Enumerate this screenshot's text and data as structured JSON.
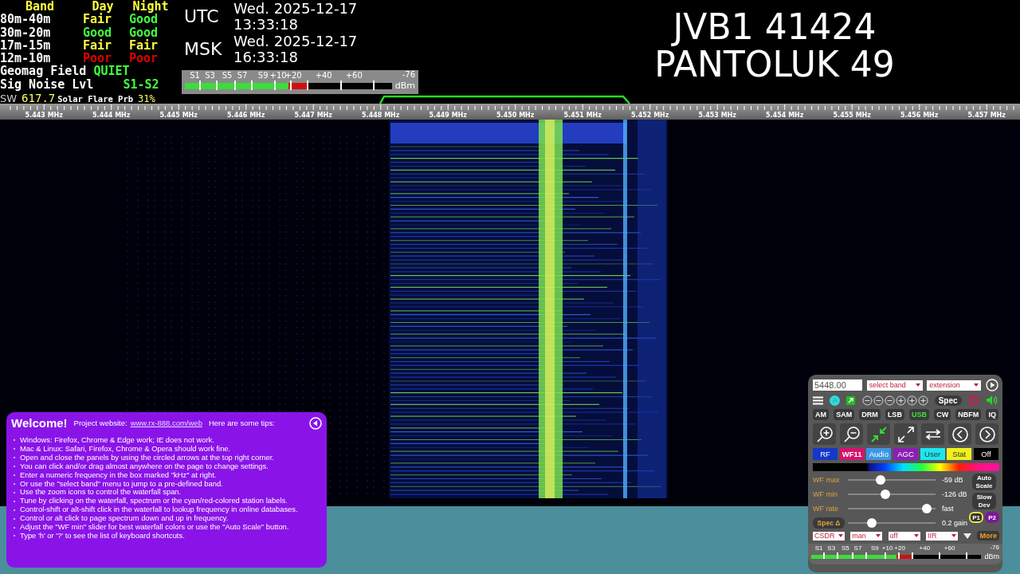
{
  "propagation": {
    "headers": [
      "Band",
      "Day",
      "Night"
    ],
    "rows": [
      {
        "band": "80m-40m",
        "day": {
          "text": "Fair",
          "color": "#ffff40"
        },
        "night": {
          "text": "Good",
          "color": "#40ff40"
        }
      },
      {
        "band": "30m-20m",
        "day": {
          "text": "Good",
          "color": "#40ff40"
        },
        "night": {
          "text": "Good",
          "color": "#40ff40"
        }
      },
      {
        "band": "17m-15m",
        "day": {
          "text": "Fair",
          "color": "#ffff40"
        },
        "night": {
          "text": "Fair",
          "color": "#ffff40"
        }
      },
      {
        "band": "12m-10m",
        "day": {
          "text": "Poor",
          "color": "#e00000"
        },
        "night": {
          "text": "Poor",
          "color": "#e00000"
        }
      }
    ],
    "geomag": {
      "label": "Geomag Field",
      "value": "QUIET"
    },
    "noise": {
      "label": "Sig Noise Lvl",
      "value": "S1-S2"
    },
    "solar": {
      "sw_label": "SW",
      "sw_value": "617.7",
      "flare_label": "Solar Flare Prb",
      "flare_value": "31%"
    }
  },
  "clocks": [
    {
      "zone": "UTC",
      "date": "Wed. 2025-12-17",
      "time": "13:33:18"
    },
    {
      "zone": "MSK",
      "date": "Wed. 2025-12-17",
      "time": "16:33:18"
    }
  ],
  "smeter": {
    "ticks": [
      "S1",
      "S3",
      "S5",
      "S7",
      "S9",
      "+10",
      "+20",
      "+40",
      "+60"
    ],
    "reading": "-76",
    "unit": "dBm",
    "level": 0.59
  },
  "station": {
    "line1": "JVB1 41424",
    "line2": "PANTOLUK 49"
  },
  "scale": {
    "labels": [
      "5.443 MHz",
      "5.444 MHz",
      "5.445 MHz",
      "5.446 MHz",
      "5.447 MHz",
      "5.448 MHz",
      "5.449 MHz",
      "5.450 MHz",
      "5.451 MHz",
      "5.452 MHz",
      "5.453 MHz",
      "5.454 MHz",
      "5.455 MHz",
      "5.456 MHz",
      "5.457 MHz"
    ]
  },
  "welcome": {
    "title": "Welcome!",
    "website_label": "Project website:",
    "website_link": "www.rx-888.com/web",
    "tips_label": "Here are some tips:",
    "tips": [
      "Windows: Firefox, Chrome & Edge work; IE does not work.",
      "Mac & Linux: Safari, Firefox, Chrome & Opera should work fine.",
      "Open and close the panels by using the circled arrows at the top right corner.",
      "You can click and/or drag almost anywhere on the page to change settings.",
      "Enter a numeric frequency in the box marked \"kHz\" at right.",
      "Or use the \"select band\" menu to jump to a pre-defined band.",
      "Use the zoom icons to control the waterfall span.",
      "Tune by clicking on the waterfall, spectrum or the cyan/red-colored station labels.",
      "Control-shift or alt-shift click in the waterfall to lookup frequency in online databases.",
      "Control or alt click to page spectrum down and up in frequency.",
      "Adjust the \"WF min\" slider for best waterfall colors or use the \"Auto Scale\" button.",
      "Type 'h' or '?' to see the list of keyboard shortcuts."
    ]
  },
  "panel": {
    "frequency": "5448.00",
    "band_select": "select band",
    "extension_select": "extension",
    "auto_badge": "A",
    "spec_button": "Spec",
    "modes": [
      {
        "label": "AM",
        "selected": false
      },
      {
        "label": "SAM",
        "selected": false
      },
      {
        "label": "DRM",
        "selected": false
      },
      {
        "label": "LSB",
        "selected": false
      },
      {
        "label": "USB",
        "selected": true
      },
      {
        "label": "CW",
        "selected": false
      },
      {
        "label": "NBFM",
        "selected": false
      },
      {
        "label": "IQ",
        "selected": false
      }
    ],
    "tabs": [
      {
        "label": "RF",
        "color": "#1438c8",
        "selected": false
      },
      {
        "label": "WF11",
        "color": "#d4146e",
        "selected": true
      },
      {
        "label": "Audio",
        "color": "#3c96e6",
        "selected": false
      },
      {
        "label": "AGC",
        "color": "#8c1eb4",
        "selected": false
      },
      {
        "label": "User",
        "color": "#1ee6f0",
        "selected": false
      },
      {
        "label": "Stat",
        "color": "#f0f01e",
        "selected": false
      },
      {
        "label": "Off",
        "color": "#000000",
        "selected": false
      }
    ],
    "sliders": [
      {
        "kind": "label",
        "label": "WF max",
        "level": 0.36,
        "reading": "-59 dB"
      },
      {
        "kind": "label",
        "label": "WF min",
        "level": 0.42,
        "reading": "-126 dB"
      },
      {
        "kind": "label",
        "label": "WF rate",
        "level": 0.95,
        "reading": "fast"
      },
      {
        "kind": "button",
        "label": "Spec Δ",
        "level": 0.24,
        "reading": "0.2 gain"
      }
    ],
    "side_buttons": [
      "Auto Scale",
      "Slow Dev"
    ],
    "presets": [
      {
        "label": "P1",
        "selected": true
      },
      {
        "label": "P2",
        "selected": false
      }
    ],
    "selects": [
      "CSDR",
      "man",
      "off",
      "IIR"
    ],
    "more_button": "More",
    "smeter": {
      "ticks": [
        "S1",
        "S3",
        "S5",
        "S7",
        "S9",
        "+10",
        "+20",
        "+40",
        "+60"
      ],
      "reading": "-76",
      "unit": "dBm",
      "level": 0.59
    }
  }
}
